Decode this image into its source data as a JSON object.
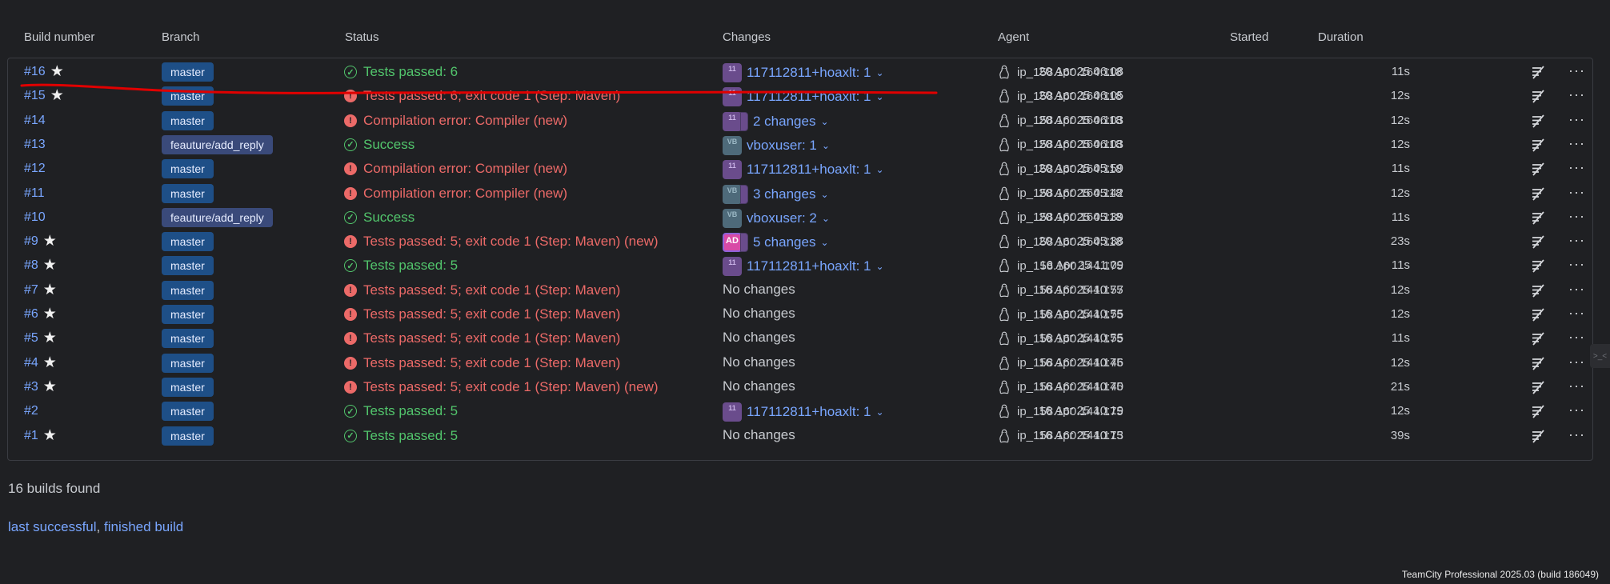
{
  "columns": {
    "build_number": "Build number",
    "branch": "Branch",
    "status": "Status",
    "changes": "Changes",
    "agent": "Agent",
    "started": "Started",
    "duration": "Duration"
  },
  "builds": [
    {
      "number": "#16",
      "starred": true,
      "branch": "master",
      "status_type": "ok",
      "status": "Tests passed: 6",
      "avatar": "11",
      "avatar_type": "user",
      "stacked": false,
      "changes": "117112811+hoaxlt: 1",
      "has_changes": true,
      "agent": "ip_158.160.164.118",
      "started": "20 Apr 25 06:08",
      "duration": "11s"
    },
    {
      "number": "#15",
      "starred": true,
      "branch": "master",
      "status_type": "err",
      "status": "Tests passed: 6; exit code 1 (Step: Maven)",
      "avatar": "11",
      "avatar_type": "user",
      "stacked": false,
      "changes": "117112811+hoaxlt: 1",
      "has_changes": true,
      "agent": "ip_158.160.164.118",
      "started": "20 Apr 25 06:05",
      "duration": "12s"
    },
    {
      "number": "#14",
      "starred": false,
      "branch": "master",
      "status_type": "err",
      "status": "Compilation error: Compiler (new)",
      "avatar": "11",
      "avatar_type": "user",
      "stacked": true,
      "changes": "2 changes",
      "has_changes": true,
      "agent": "ip_158.160.164.118",
      "started": "20 Apr 25 06:03",
      "duration": "12s"
    },
    {
      "number": "#13",
      "starred": false,
      "branch": "feauture/add_reply",
      "status_type": "ok",
      "status": "Success",
      "avatar": "VB",
      "avatar_type": "vb",
      "stacked": false,
      "changes": "vboxuser: 1",
      "has_changes": true,
      "agent": "ip_158.160.164.118",
      "started": "20 Apr 25 06:03",
      "duration": "12s"
    },
    {
      "number": "#12",
      "starred": false,
      "branch": "master",
      "status_type": "err",
      "status": "Compilation error: Compiler (new)",
      "avatar": "11",
      "avatar_type": "user",
      "stacked": false,
      "changes": "117112811+hoaxlt: 1",
      "has_changes": true,
      "agent": "ip_158.160.164.118",
      "started": "20 Apr 25 05:59",
      "duration": "11s"
    },
    {
      "number": "#11",
      "starred": false,
      "branch": "master",
      "status_type": "err",
      "status": "Compilation error: Compiler (new)",
      "avatar": "VB",
      "avatar_type": "vb",
      "stacked": true,
      "changes": "3 changes",
      "has_changes": true,
      "agent": "ip_158.160.164.118",
      "started": "20 Apr 25 05:42",
      "duration": "12s"
    },
    {
      "number": "#10",
      "starred": false,
      "branch": "feauture/add_reply",
      "status_type": "ok",
      "status": "Success",
      "avatar": "VB",
      "avatar_type": "vb",
      "stacked": false,
      "changes": "vboxuser: 2",
      "has_changes": true,
      "agent": "ip_158.160.164.118",
      "started": "20 Apr 25 05:39",
      "duration": "11s"
    },
    {
      "number": "#9",
      "starred": true,
      "branch": "master",
      "status_type": "err",
      "status": "Tests passed: 5; exit code 1 (Step: Maven) (new)",
      "avatar": "AD",
      "avatar_type": "ad",
      "stacked": true,
      "changes": "5 changes",
      "has_changes": true,
      "agent": "ip_158.160.164.118",
      "started": "20 Apr 25 05:38",
      "duration": "23s"
    },
    {
      "number": "#8",
      "starred": true,
      "branch": "master",
      "status_type": "ok",
      "status": "Tests passed: 5",
      "avatar": "11",
      "avatar_type": "user",
      "stacked": false,
      "changes": "117112811+hoaxlt: 1",
      "has_changes": true,
      "agent": "ip_158.160.144.175",
      "started": "16 Apr 25 11:09",
      "duration": "11s"
    },
    {
      "number": "#7",
      "starred": true,
      "branch": "master",
      "status_type": "err",
      "status": "Tests passed: 5; exit code 1 (Step: Maven)",
      "avatar": "",
      "avatar_type": "none",
      "stacked": false,
      "changes": "No changes",
      "has_changes": false,
      "agent": "ip_158.160.144.175",
      "started": "16 Apr 25 10:57",
      "duration": "12s"
    },
    {
      "number": "#6",
      "starred": true,
      "branch": "master",
      "status_type": "err",
      "status": "Tests passed: 5; exit code 1 (Step: Maven)",
      "avatar": "",
      "avatar_type": "none",
      "stacked": false,
      "changes": "No changes",
      "has_changes": false,
      "agent": "ip_158.160.144.175",
      "started": "16 Apr 25 10:55",
      "duration": "12s"
    },
    {
      "number": "#5",
      "starred": true,
      "branch": "master",
      "status_type": "err",
      "status": "Tests passed: 5; exit code 1 (Step: Maven)",
      "avatar": "",
      "avatar_type": "none",
      "stacked": false,
      "changes": "No changes",
      "has_changes": false,
      "agent": "ip_158.160.144.175",
      "started": "16 Apr 25 10:55",
      "duration": "11s"
    },
    {
      "number": "#4",
      "starred": true,
      "branch": "master",
      "status_type": "err",
      "status": "Tests passed: 5; exit code 1 (Step: Maven)",
      "avatar": "",
      "avatar_type": "none",
      "stacked": false,
      "changes": "No changes",
      "has_changes": false,
      "agent": "ip_158.160.144.175",
      "started": "16 Apr 25 10:46",
      "duration": "12s"
    },
    {
      "number": "#3",
      "starred": true,
      "branch": "master",
      "status_type": "err",
      "status": "Tests passed: 5; exit code 1 (Step: Maven) (new)",
      "avatar": "",
      "avatar_type": "none",
      "stacked": false,
      "changes": "No changes",
      "has_changes": false,
      "agent": "ip_158.160.144.175",
      "started": "16 Apr 25 10:40",
      "duration": "21s"
    },
    {
      "number": "#2",
      "starred": false,
      "branch": "master",
      "status_type": "ok",
      "status": "Tests passed: 5",
      "avatar": "11",
      "avatar_type": "user",
      "stacked": false,
      "changes": "117112811+hoaxlt: 1",
      "has_changes": true,
      "agent": "ip_158.160.144.175",
      "started": "16 Apr 25 10:19",
      "duration": "12s"
    },
    {
      "number": "#1",
      "starred": true,
      "branch": "master",
      "status_type": "ok",
      "status": "Tests passed: 5",
      "avatar": "",
      "avatar_type": "none",
      "stacked": false,
      "changes": "No changes",
      "has_changes": false,
      "agent": "ip_158.160.144.175",
      "started": "16 Apr 25 10:13",
      "duration": "39s"
    }
  ],
  "summary": {
    "builds_found": "16 builds found",
    "last_successful": "last successful",
    "separator": ", ",
    "finished_build": "finished build"
  },
  "footer": "TeamCity Professional 2025.03 (build 186049)",
  "colors": {
    "background": "#1f2023",
    "link": "#79a6ff",
    "success": "#52c56c",
    "error": "#ec6a68",
    "branch_badge": "#1e4f87",
    "annotation": "#e00000"
  }
}
